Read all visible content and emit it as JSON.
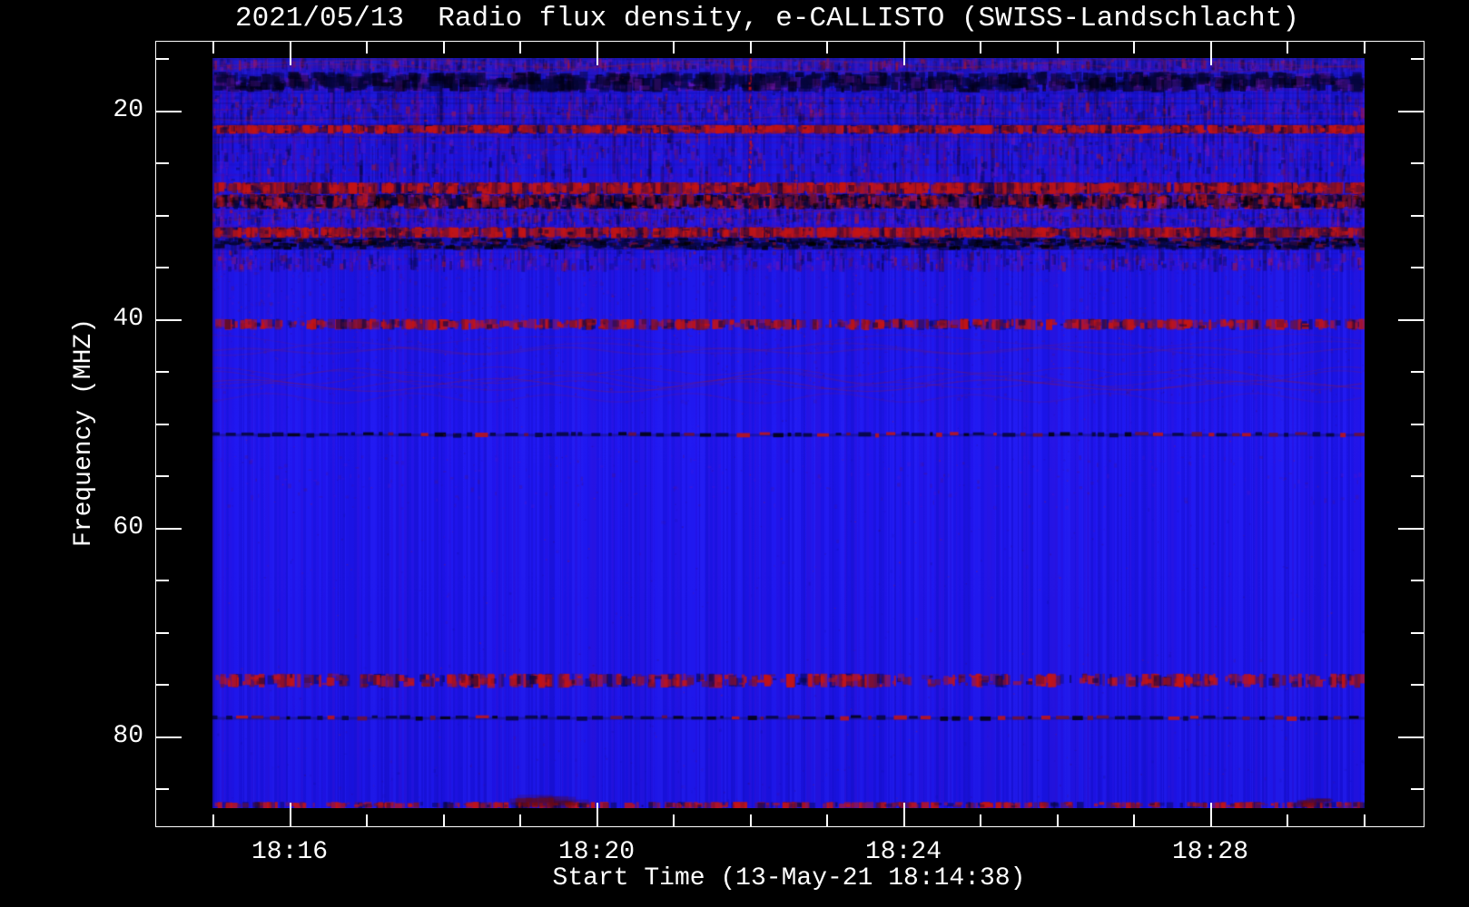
{
  "page": {
    "background": "#000000"
  },
  "chart_data": {
    "type": "heatmap",
    "title": "2021/05/13  Radio flux density, e-CALLISTO (SWISS-Landschlacht)",
    "xlabel": "Start Time (13-May-21 18:14:38)",
    "ylabel": "Frequency (MHZ)",
    "x_axis": {
      "start_time_label": "18:14:38",
      "major_ticks": [
        {
          "minute": 16,
          "label": "18:16"
        },
        {
          "minute": 20,
          "label": "18:20"
        },
        {
          "minute": 24,
          "label": "18:24"
        },
        {
          "minute": 28,
          "label": "18:28"
        }
      ],
      "minor_tick_minutes": [
        15,
        16,
        17,
        18,
        19,
        20,
        21,
        22,
        23,
        24,
        25,
        26,
        27,
        28,
        29,
        30
      ],
      "minor_tick_interval_min": 1
    },
    "y_axis": {
      "unit": "MHZ",
      "major_ticks": [
        20,
        40,
        60,
        80
      ],
      "all_ticks": [
        15,
        20,
        25,
        30,
        35,
        40,
        45,
        50,
        55,
        60,
        65,
        70,
        75,
        80,
        85
      ],
      "minor_step_mhz": 5,
      "axis_top_mhz": 13.3,
      "axis_bottom_mhz": 88.5
    },
    "display": {
      "freq_top_mhz": 15.0,
      "freq_bottom_mhz": 86.9,
      "time_start": "18:15:00",
      "time_end": "18:30:01",
      "grid": false,
      "legend": false
    },
    "palette": {
      "background": "#000000",
      "frame": "#ffffff",
      "base_blue": "#1d15ee",
      "purple": "#7a16b4",
      "dark_navy": "#06063c",
      "near_black": "#000014",
      "red": "#c41414",
      "maroon": "#741030"
    },
    "features": {
      "bands": [
        {
          "f0": 15.0,
          "f1": 16.3,
          "type": "noisy",
          "intensity": 0.5
        },
        {
          "f0": 16.3,
          "f1": 18.3,
          "type": "dark_patches",
          "intensity": 0.8
        },
        {
          "f0": 18.3,
          "f1": 21.3,
          "type": "noisy",
          "intensity": 0.6
        },
        {
          "f0": 21.4,
          "f1": 22.2,
          "type": "red_speckle_row",
          "intensity": 0.8
        },
        {
          "f0": 22.2,
          "f1": 26.9,
          "type": "noisy",
          "intensity": 0.55
        },
        {
          "f0": 26.9,
          "f1": 28.0,
          "type": "red_speckle_row",
          "intensity": 0.85
        },
        {
          "f0": 28.0,
          "f1": 29.5,
          "type": "dark_red_mix",
          "intensity": 0.9
        },
        {
          "f0": 29.5,
          "f1": 31.2,
          "type": "noisy",
          "intensity": 0.6
        },
        {
          "f0": 31.2,
          "f1": 32.2,
          "type": "red_speckle_row",
          "intensity": 0.85
        },
        {
          "f0": 32.2,
          "f1": 33.4,
          "type": "dark_dash_band",
          "intensity": 0.85
        },
        {
          "f0": 33.4,
          "f1": 35.5,
          "type": "noisy",
          "intensity": 0.4
        },
        {
          "f0": 35.5,
          "f1": 40.0,
          "type": "faint_noise",
          "intensity": 0.25
        },
        {
          "f0": 40.0,
          "f1": 41.0,
          "type": "red_speckle_row",
          "intensity": 0.35
        },
        {
          "f0": 41.0,
          "f1": 48.0,
          "type": "ripples",
          "intensity": 0.3
        },
        {
          "f0": 50.8,
          "f1": 51.4,
          "type": "rfi_dash_line",
          "intensity": 0.9
        },
        {
          "f0": 53.0,
          "f1": 58.0,
          "type": "faint_noise",
          "intensity": 0.2
        },
        {
          "f0": 58.0,
          "f1": 73.5,
          "type": "quiet",
          "intensity": 0.1
        },
        {
          "f0": 74.0,
          "f1": 75.3,
          "type": "red_speckle_row",
          "intensity": 0.3
        },
        {
          "f0": 77.9,
          "f1": 78.6,
          "type": "rfi_dash_line",
          "intensity": 0.8
        },
        {
          "f0": 78.6,
          "f1": 86.2,
          "type": "quiet",
          "intensity": 0.12
        },
        {
          "f0": 86.3,
          "f1": 86.9,
          "type": "red_speckle_row",
          "intensity": 0.25
        }
      ],
      "events": [
        {
          "type": "red_burst_column",
          "time_min": 22.0,
          "f0": 15.0,
          "f1": 30.0
        },
        {
          "type": "red_blotch",
          "time_min": 19.2,
          "width_min": 1.0,
          "f0": 85.6,
          "f1": 86.9
        },
        {
          "type": "red_blotch",
          "time_min": 29.3,
          "width_min": 0.35,
          "f0": 85.9,
          "f1": 86.9
        }
      ]
    },
    "seed": 1305
  }
}
